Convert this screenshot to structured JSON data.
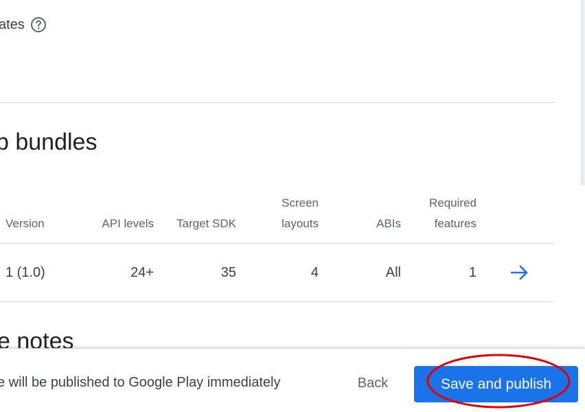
{
  "top": {
    "label_partial": "ates",
    "help_icon": "help-circle-icon"
  },
  "section": {
    "title_partial": "p bundles"
  },
  "table": {
    "headers": {
      "version": "Version",
      "api_levels": "API levels",
      "target_sdk": "Target SDK",
      "screen_layouts_1": "Screen",
      "screen_layouts_2": "layouts",
      "abis": "ABIs",
      "required_features_1": "Required",
      "required_features_2": "features"
    },
    "row": {
      "version": "1 (1.0)",
      "api_levels": "24+",
      "target_sdk": "35",
      "screen_layouts": "4",
      "abis": "All",
      "required_features": "1",
      "details_icon": "arrow-right-icon"
    }
  },
  "next_section": {
    "title_partial": "e notes"
  },
  "footer": {
    "message_partial": "e will be published to Google Play immediately",
    "back_label": "Back",
    "publish_label": "Save and publish"
  },
  "colors": {
    "primary": "#1a73e8",
    "highlight": "#e00000",
    "divider": "#dadce0",
    "text": "#3c4043",
    "header_text": "#5f6368"
  }
}
